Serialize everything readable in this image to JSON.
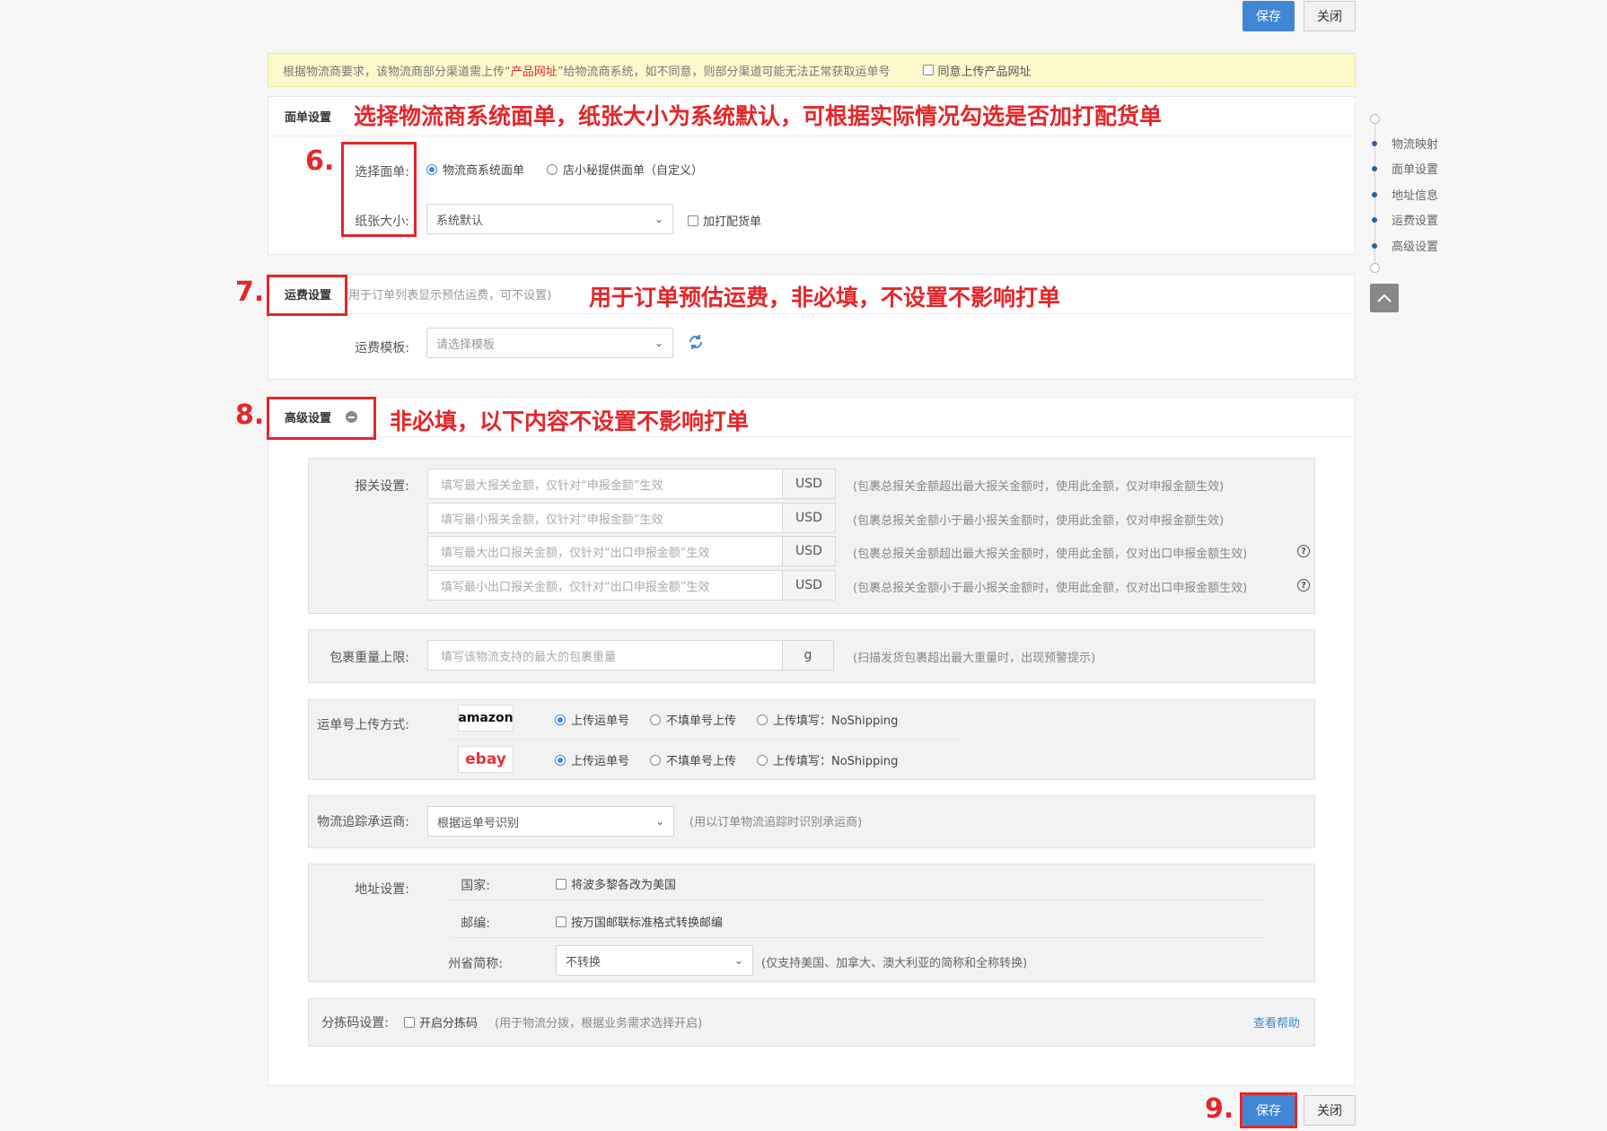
{
  "top_buttons": {
    "save": "保存",
    "close": "关闭"
  },
  "notice": {
    "text_before": "根据物流商要求，该物流商部分渠道需上传“",
    "highlight": "产品网址",
    "text_after": "”给物流商系统，如不同意，则部分渠道可能无法正常获取运单号",
    "checkbox_label": "同意上传产品网址"
  },
  "annotations": {
    "n6": "6.",
    "n7": "7.",
    "n8": "8.",
    "n9": "9.",
    "t6": "选择物流商系统面单，纸张大小为系统默认，可根据实际情况勾选是否加打配货单",
    "t7": "用于订单预估运费，非必填，不设置不影响打单",
    "t8": "非必填，以下内容不设置不影响打单"
  },
  "label_section": {
    "title": "面单设置",
    "select_label": "选择面单:",
    "opt_system": "物流商系统面单",
    "opt_shop": "店小秘提供面单（自定义）",
    "paper_label": "纸张大小:",
    "paper_value": "系统默认",
    "add_packing": "加打配货单"
  },
  "freight_section": {
    "title": "运费设置",
    "desc": "(用于订单列表显示预估运费，可不设置)",
    "template_label": "运费模板:",
    "template_placeholder": "请选择模板"
  },
  "advanced_section": {
    "title": "高级设置",
    "customs": {
      "label": "报关设置:",
      "rows": [
        {
          "placeholder": "填写最大报关金额，仅针对“申报金额”生效",
          "unit": "USD",
          "hint": "(包裹总报关金额超出最大报关金额时，使用此金额，仅对申报金额生效)"
        },
        {
          "placeholder": "填写最小报关金额，仅针对“申报金额”生效",
          "unit": "USD",
          "hint": "(包裹总报关金额小于最小报关金额时，使用此金额，仅对申报金额生效)"
        },
        {
          "placeholder": "填写最大出口报关金额，仅针对“出口申报金额”生效",
          "unit": "USD",
          "hint": "(包裹总报关金额超出最大报关金额时，使用此金额，仅对出口申报金额生效)"
        },
        {
          "placeholder": "填写最小出口报关金额，仅针对“出口申报金额”生效",
          "unit": "USD",
          "hint": "(包裹总报关金额小于最小报关金额时，使用此金额，仅对出口申报金额生效)"
        }
      ]
    },
    "weight": {
      "label": "包裹重量上限:",
      "placeholder": "填写该物流支持的最大的包裹重量",
      "unit": "g",
      "hint": "(扫描发货包裹超出最大重量时，出现预警提示)"
    },
    "upload": {
      "label": "运单号上传方式:",
      "platforms": [
        {
          "name": "amazon",
          "opt1": "上传运单号",
          "opt2": "不填单号上传",
          "opt3": "上传填写：NoShipping"
        },
        {
          "name": "ebay",
          "opt1": "上传运单号",
          "opt2": "不填单号上传",
          "opt3": "上传填写：NoShipping"
        }
      ]
    },
    "tracking": {
      "label": "物流追踪承运商:",
      "value": "根据运单号识别",
      "hint": "(用以订单物流追踪时识别承运商)"
    },
    "address": {
      "label": "地址设置:",
      "country_label": "国家:",
      "country_opt": "将波多黎各改为美国",
      "zip_label": "邮编:",
      "zip_opt": "按万国邮联标准格式转换邮编",
      "state_label": "州省简称:",
      "state_value": "不转换",
      "state_hint": "(仅支持美国、加拿大、澳大利亚的简称和全称转换)"
    },
    "sort": {
      "label": "分拣码设置:",
      "opt": "开启分拣码",
      "hint": "(用于物流分拨，根据业务需求选择开启)",
      "help": "查看帮助"
    }
  },
  "side_nav": [
    "物流映射",
    "面单设置",
    "地址信息",
    "运费设置",
    "高级设置"
  ],
  "colors": {
    "accent": "#3f87d4",
    "annotation": "#e5262a",
    "notice_bg": "#fdf9cc"
  }
}
